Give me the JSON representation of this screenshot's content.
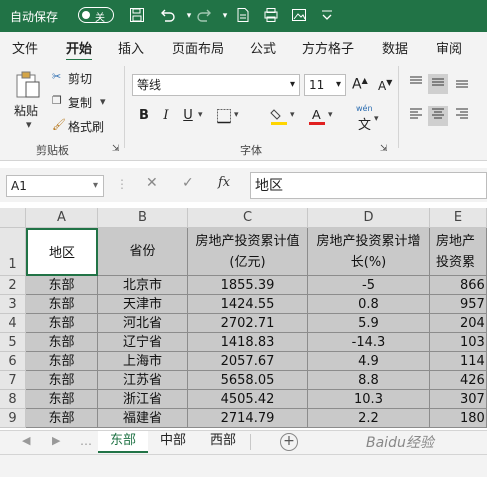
{
  "titlebar": {
    "autosave_label": "自动保存",
    "toggle_text": "关",
    "bg": "#217346"
  },
  "menu": {
    "tabs": [
      {
        "label": "文件"
      },
      {
        "label": "开始"
      },
      {
        "label": "插入"
      },
      {
        "label": "页面布局"
      },
      {
        "label": "公式"
      },
      {
        "label": "方方格子"
      },
      {
        "label": "数据"
      },
      {
        "label": "审阅"
      }
    ],
    "active": "开始"
  },
  "ribbon": {
    "paste_label": "粘贴",
    "cut_label": "剪切",
    "copy_label": "复制",
    "format_painter_label": "格式刷",
    "clipboard_group": "剪贴板",
    "font_name": "等线",
    "font_size": "11",
    "font_group": "字体",
    "bold": "B",
    "italic": "I",
    "underline": "U",
    "phonetic_label": "wén"
  },
  "formula_bar": {
    "name_box": "A1",
    "formula": "地区",
    "fx_label": "fx"
  },
  "grid": {
    "columns": [
      "A",
      "B",
      "C",
      "D",
      "E"
    ],
    "header_row": {
      "row_num": "1",
      "cells": [
        "地区",
        "省份",
        "房地产投资累计值(亿元)",
        "房地产投资累计增长(%)",
        "房地产投资累计值"
      ]
    },
    "rows": [
      {
        "num": "2",
        "cells": [
          "东部",
          "北京市",
          "1855.39",
          "-5",
          "866"
        ]
      },
      {
        "num": "3",
        "cells": [
          "东部",
          "天津市",
          "1424.55",
          "0.8",
          "957"
        ]
      },
      {
        "num": "4",
        "cells": [
          "东部",
          "河北省",
          "2702.71",
          "5.9",
          "204"
        ]
      },
      {
        "num": "5",
        "cells": [
          "东部",
          "辽宁省",
          "1418.83",
          "-14.3",
          "103"
        ]
      },
      {
        "num": "6",
        "cells": [
          "东部",
          "上海市",
          "2057.67",
          "4.9",
          "114"
        ]
      },
      {
        "num": "7",
        "cells": [
          "东部",
          "江苏省",
          "5658.05",
          "8.8",
          "426"
        ]
      },
      {
        "num": "8",
        "cells": [
          "东部",
          "浙江省",
          "4505.42",
          "10.3",
          "307"
        ]
      },
      {
        "num": "9",
        "cells": [
          "东部",
          "福建省",
          "2714.79",
          "2.2",
          "180"
        ]
      }
    ]
  },
  "sheets": {
    "tabs": [
      {
        "label": "东部"
      },
      {
        "label": "中部"
      },
      {
        "label": "西部"
      }
    ],
    "active": "东部",
    "add_icon": "plus-icon"
  },
  "watermark": "Baidu经验",
  "colors": {
    "accent": "#217346",
    "selection": "#c9c9c9",
    "header": "#e6e6e6"
  }
}
